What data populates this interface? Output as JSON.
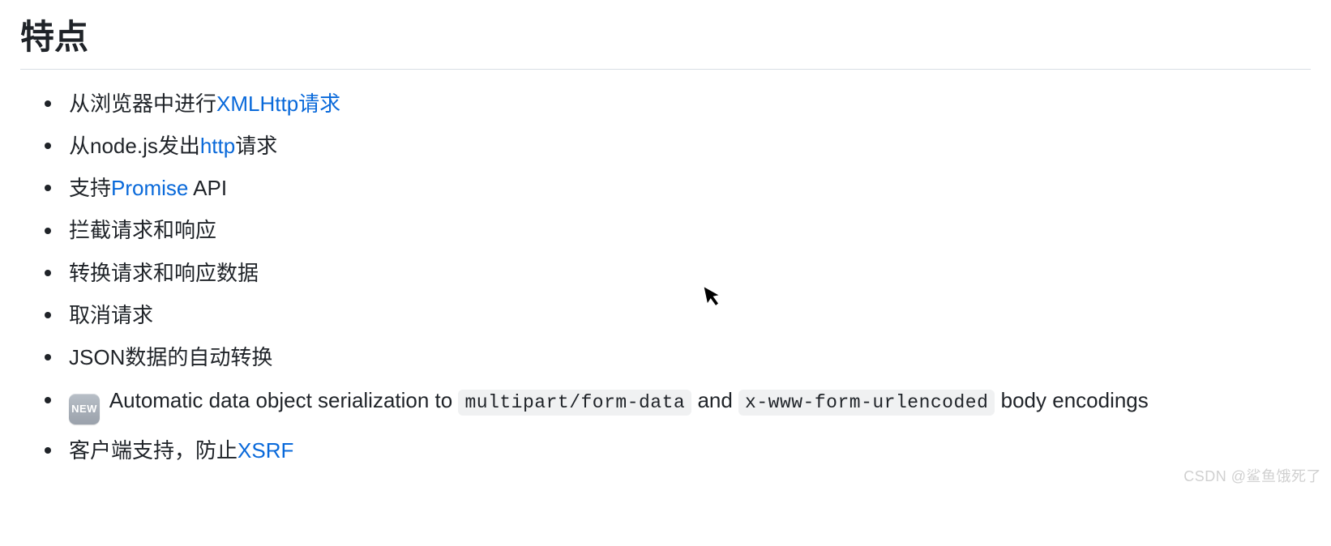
{
  "heading": "特点",
  "items": [
    {
      "parts": [
        {
          "type": "text",
          "value": "从浏览器中进行"
        },
        {
          "type": "link",
          "value": "XMLHttp请求"
        }
      ]
    },
    {
      "parts": [
        {
          "type": "text",
          "value": "从node.js发出"
        },
        {
          "type": "link",
          "value": "http"
        },
        {
          "type": "text",
          "value": "请求"
        }
      ]
    },
    {
      "parts": [
        {
          "type": "text",
          "value": "支持"
        },
        {
          "type": "link",
          "value": "Promise"
        },
        {
          "type": "text",
          "value": " API"
        }
      ]
    },
    {
      "parts": [
        {
          "type": "text",
          "value": "拦截请求和响应"
        }
      ]
    },
    {
      "parts": [
        {
          "type": "text",
          "value": "转换请求和响应数据"
        }
      ]
    },
    {
      "parts": [
        {
          "type": "text",
          "value": "取消请求"
        }
      ]
    },
    {
      "parts": [
        {
          "type": "text",
          "value": "JSON数据的自动转换"
        }
      ]
    },
    {
      "parts": [
        {
          "type": "badge",
          "value": "NEW"
        },
        {
          "type": "text",
          "value": " Automatic data object serialization to "
        },
        {
          "type": "code",
          "value": "multipart/form-data"
        },
        {
          "type": "text",
          "value": " and "
        },
        {
          "type": "code",
          "value": "x-www-form-urlencoded"
        },
        {
          "type": "text",
          "value": " body encodings"
        }
      ]
    },
    {
      "parts": [
        {
          "type": "text",
          "value": "客户端支持，防止"
        },
        {
          "type": "link",
          "value": "XSRF"
        }
      ]
    }
  ],
  "watermark": "CSDN @鲨鱼饿死了",
  "cursor_glyph": "➤"
}
